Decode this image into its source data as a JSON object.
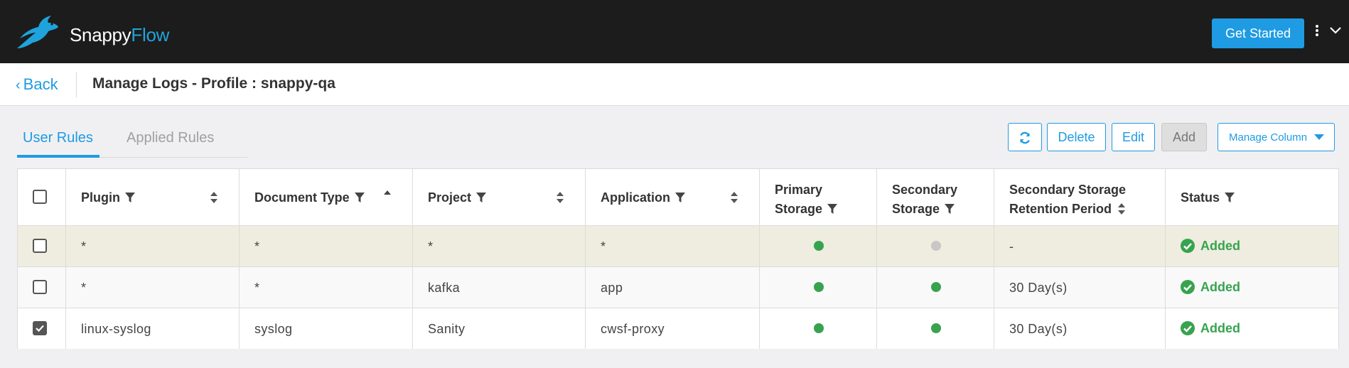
{
  "brand": {
    "part1": "Snappy",
    "part2": "Flow",
    "logo_icon": "rabbit-logo-icon"
  },
  "topbar": {
    "get_started_label": "Get Started",
    "menu_icon": "kebab-menu-icon",
    "dropdown_icon": "chevron-down-icon"
  },
  "header": {
    "back_label": "Back",
    "page_title": "Manage Logs - Profile : snappy-qa"
  },
  "tabs": [
    {
      "label": "User Rules",
      "active": true
    },
    {
      "label": "Applied Rules",
      "active": false
    }
  ],
  "toolbar": {
    "refresh_icon": "refresh-icon",
    "delete_label": "Delete",
    "edit_label": "Edit",
    "add_label": "Add",
    "manage_column_label": "Manage Column"
  },
  "table": {
    "columns": [
      {
        "label": "Plugin",
        "filter": true,
        "sort": "both"
      },
      {
        "label": "Document Type",
        "filter": true,
        "sort": "asc"
      },
      {
        "label": "Project",
        "filter": true,
        "sort": "both"
      },
      {
        "label": "Application",
        "filter": true,
        "sort": "both"
      },
      {
        "label_line1": "Primary",
        "label_line2": "Storage",
        "filter": true
      },
      {
        "label_line1": "Secondary",
        "label_line2": "Storage",
        "filter": true
      },
      {
        "label_line1": "Secondary Storage",
        "label_line2": "Retention Period",
        "sort": "both"
      },
      {
        "label": "Status",
        "filter": true
      }
    ],
    "rows": [
      {
        "checked": false,
        "plugin": "*",
        "document_type": "*",
        "project": "*",
        "application": "*",
        "primary_storage": "enabled",
        "secondary_storage": "disabled",
        "retention": "-",
        "status": "Added"
      },
      {
        "checked": false,
        "plugin": "*",
        "document_type": "*",
        "project": "kafka",
        "application": "app",
        "primary_storage": "enabled",
        "secondary_storage": "enabled",
        "retention": "30 Day(s)",
        "status": "Added"
      },
      {
        "checked": true,
        "plugin": "linux-syslog",
        "document_type": "syslog",
        "project": "Sanity",
        "application": "cwsf-proxy",
        "primary_storage": "enabled",
        "secondary_storage": "enabled",
        "retention": "30 Day(s)",
        "status": "Added"
      }
    ]
  },
  "colors": {
    "accent": "#1e9be3",
    "status_green": "#37a34f",
    "storage_off": "#c7c7c7",
    "highlight_row": "#eeeddf"
  }
}
